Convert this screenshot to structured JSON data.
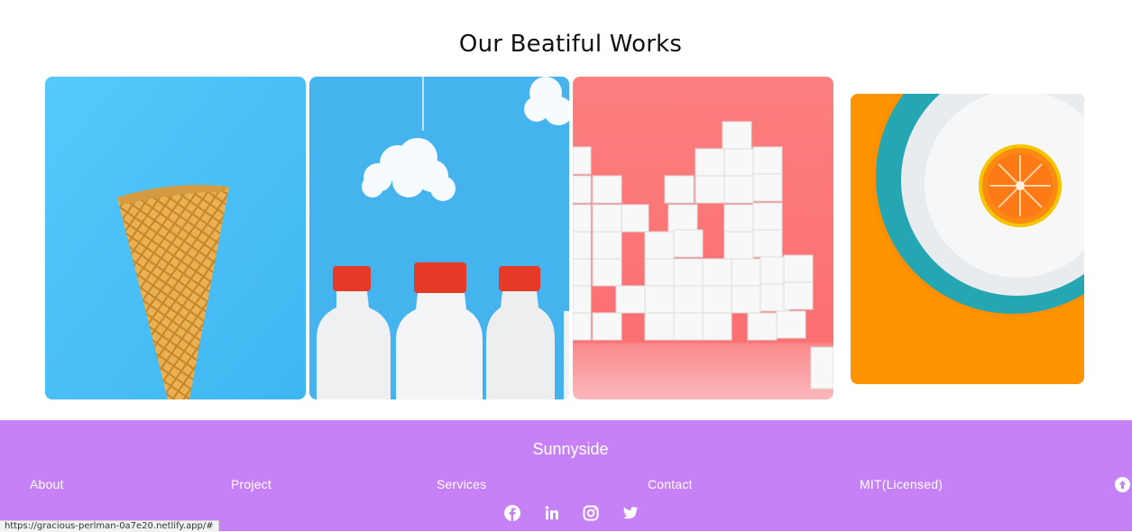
{
  "works": {
    "title": "Our Beatiful Works",
    "items": [
      {
        "icon": "ice-cream-cone-image",
        "bg": "#4cc3f7"
      },
      {
        "icon": "milk-bottles-image",
        "bg": "#45b4ef"
      },
      {
        "icon": "sugar-cubes-image",
        "bg": "#fd7b7b"
      },
      {
        "icon": "orange-on-plate-image",
        "bg": "#fe9400"
      }
    ]
  },
  "footer": {
    "brand": "Sunnyside",
    "links": [
      "About",
      "Project",
      "Services",
      "Contact",
      "MIT(Licensed)"
    ],
    "social": [
      "facebook-icon",
      "linkedin-icon",
      "instagram-icon",
      "twitter-icon"
    ],
    "scroll_top_icon": "arrow-up-circle-icon",
    "bg": "#c681f7"
  },
  "status_bar": {
    "url": "https://gracious-perlman-0a7e20.netlify.app/#"
  }
}
